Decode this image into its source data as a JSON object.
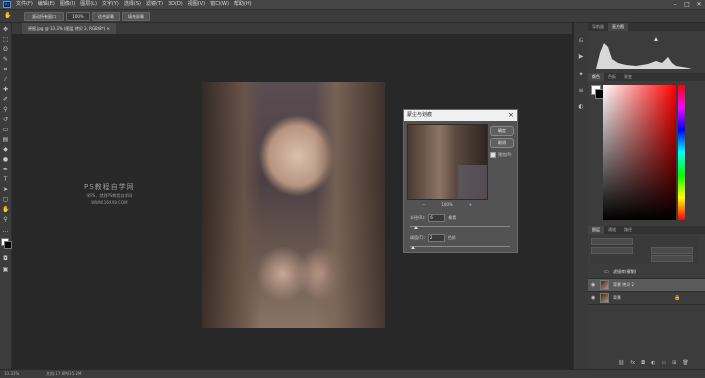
{
  "menubar": {
    "logo": "Ps",
    "menus": [
      "文件(F)",
      "编辑(E)",
      "图像(I)",
      "图层(L)",
      "文字(Y)",
      "选择(S)",
      "滤镜(T)",
      "3D(D)",
      "视图(V)",
      "窗口(W)",
      "帮助(H)"
    ],
    "min": "–",
    "max": "□",
    "close": "✕"
  },
  "options": {
    "btn1": "滚动所有窗口",
    "zoom": "100%",
    "btn2": "适合屏幕",
    "btn3": "填充屏幕"
  },
  "tab": {
    "label": "原图.jpg @ 33.3% (图层 拷贝 2, RGB/8*) ✕"
  },
  "watermark": {
    "line1": "PS教程自学网",
    "line2": "学PS，就到PS教程自学网",
    "line3": "WWW.16XX8.COM"
  },
  "dialog": {
    "title": "蒙尘与划痕",
    "ok": "确定",
    "cancel": "取消",
    "preview_label": "预览(P)",
    "zoom_out": "−",
    "zoom_value": "100%",
    "zoom_in": "+",
    "radius_label": "半径(R):",
    "radius_value": "6",
    "radius_unit": "像素",
    "threshold_label": "阈值(T):",
    "threshold_value": "2",
    "threshold_unit": "色阶"
  },
  "panels": {
    "top_tabs": [
      "导航器",
      "直方图"
    ],
    "color_tabs": [
      "颜色",
      "色板",
      "渐变"
    ],
    "layer_tabs": [
      "图层",
      "通道",
      "路径"
    ],
    "layers": [
      {
        "name": "滤镜库(模糊)"
      },
      {
        "name": "背景 拷贝 2"
      },
      {
        "name": "背景"
      }
    ]
  },
  "status": {
    "zoom": "33.33%",
    "doc": "文档:17.6M/35.2M"
  }
}
